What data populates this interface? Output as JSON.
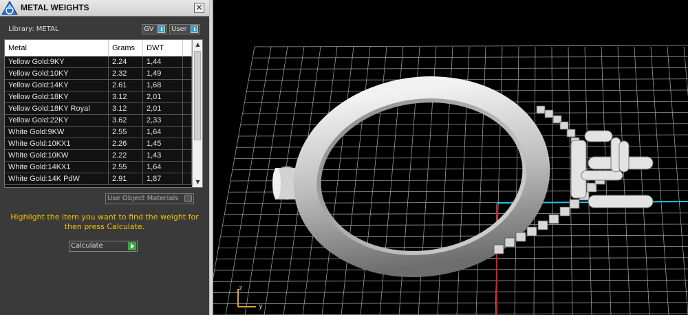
{
  "window": {
    "title": "METAL WEIGHTS",
    "close_glyph": "✕"
  },
  "library": {
    "label": "Library: METAL"
  },
  "toggles": {
    "gv": "GV",
    "user": "User"
  },
  "table": {
    "columns": [
      "Metal",
      "Grams",
      "DWT"
    ],
    "rows": [
      [
        "Yellow Gold:9KY",
        "2.24",
        "1,44"
      ],
      [
        "Yellow Gold:10KY",
        "2.32",
        "1,49"
      ],
      [
        "Yellow Gold:14KY",
        "2.61",
        "1,68"
      ],
      [
        "Yellow Gold:18KY",
        "3.12",
        "2,01"
      ],
      [
        "Yellow Gold:18KY Royal",
        "3.12",
        "2,01"
      ],
      [
        "Yellow Gold:22KY",
        "3.62",
        "2,33"
      ],
      [
        "White Gold:9KW",
        "2.55",
        "1,64"
      ],
      [
        "White Gold:10KX1",
        "2.26",
        "1,45"
      ],
      [
        "White Gold:10KW",
        "2.22",
        "1,43"
      ],
      [
        "White Gold:14KX1",
        "2.55",
        "1,64"
      ],
      [
        "White Gold:14K PdW",
        "2.91",
        "1,87"
      ]
    ]
  },
  "use_object_materials": "Use Object Materials",
  "instruction": "Highlight the item you want to find the weight for then press Calculate.",
  "calculate_label": "Calculate",
  "viewport": {
    "axis_z": "z",
    "axis_y": "y",
    "grid_color": "#9a9a9a",
    "axis_red": "#d62020",
    "axis_cyan": "#1ec8e0"
  },
  "colors": {
    "instruction": "#f2c200",
    "toggle_accent": "#3a9fbf",
    "calculate_go": "#38a838"
  }
}
